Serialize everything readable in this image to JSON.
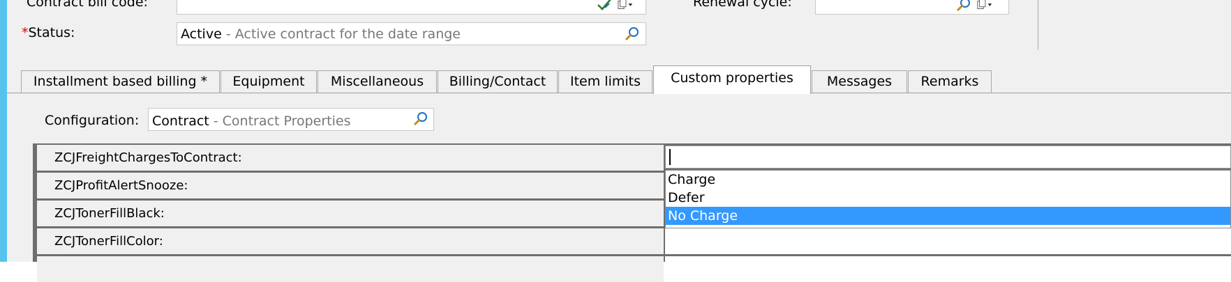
{
  "form": {
    "contract_bill_code_label": "Contract bill code:",
    "renewal_cycle_label": "Renewal cycle:",
    "status_required_mark": "*",
    "status_label": "Status:",
    "status_value": "Active",
    "status_description": " - Active contract for the date range"
  },
  "tabs": [
    {
      "label": "Installment based billing *"
    },
    {
      "label": "Equipment"
    },
    {
      "label": "Miscellaneous"
    },
    {
      "label": "Billing/Contact"
    },
    {
      "label": "Item limits"
    },
    {
      "label": "Custom properties"
    },
    {
      "label": "Messages"
    },
    {
      "label": "Remarks"
    }
  ],
  "active_tab": "Custom properties",
  "configuration": {
    "label": "Configuration:",
    "value": "Contract",
    "description": " - Contract Properties"
  },
  "properties": [
    {
      "name": "ZCJFreightChargesToContract:"
    },
    {
      "name": "ZCJProfitAlertSnooze:"
    },
    {
      "name": "ZCJTonerFillBlack:"
    },
    {
      "name": "ZCJTonerFillColor:"
    }
  ],
  "dropdown": {
    "input_value": "",
    "options": [
      "Charge",
      "Defer",
      "No Charge"
    ],
    "selected": "No Charge"
  },
  "icons": {
    "lookup": "magnifier-icon",
    "edit": "edit-check-icon",
    "copy": "copy-dropdown-icon"
  },
  "colors": {
    "accent_bar": "#54c4ee",
    "selection": "#3399ff",
    "required": "#e00000"
  }
}
